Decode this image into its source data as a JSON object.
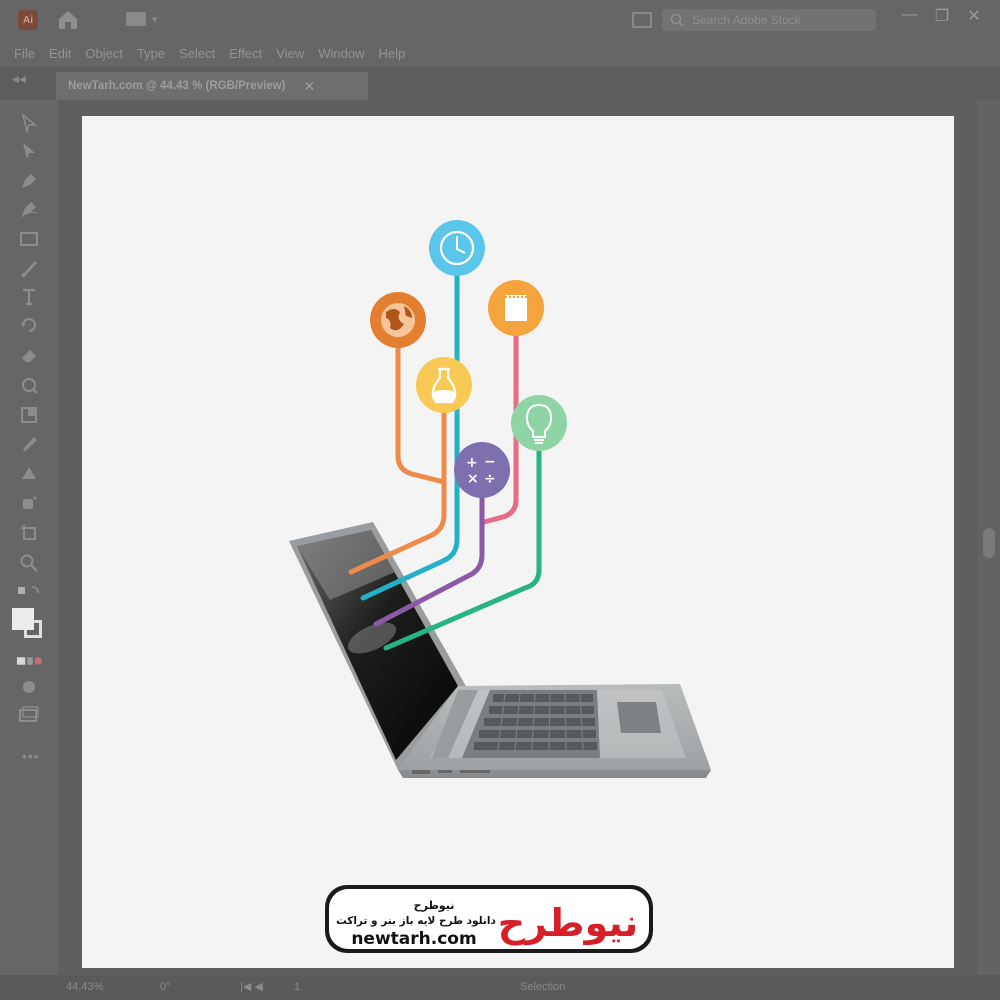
{
  "app": {
    "logo_text": "Ai"
  },
  "search": {
    "placeholder": "Search Adobe Stock"
  },
  "window": {
    "minimize": "—",
    "restore": "❐",
    "close": "✕"
  },
  "menu": [
    "File",
    "Edit",
    "Object",
    "Type",
    "Select",
    "Effect",
    "View",
    "Window",
    "Help"
  ],
  "document": {
    "tab_title": "NewTarh.com @ 44.43 % (RGB/Preview)",
    "close": "✕"
  },
  "status": {
    "zoom": "44.43%",
    "rotation": "0°",
    "page": "1",
    "tool": "Selection"
  },
  "icons": {
    "tools": [
      "selection-tool",
      "direct-selection-tool",
      "pen-tool",
      "curvature-tool",
      "rectangle-tool",
      "paintbrush-tool",
      "type-tool",
      "rotate-tool",
      "eraser-tool",
      "width-tool",
      "free-transform-tool",
      "eyedropper-tool",
      "blend-tool",
      "symbol-sprayer-tool",
      "artboard-tool",
      "zoom-tool"
    ],
    "bubbles": [
      "clock-icon",
      "globe-icon",
      "notepad-icon",
      "flask-icon",
      "lightbulb-icon",
      "math-symbols-icon"
    ]
  },
  "colors": {
    "clock": "#5bc6ea",
    "globe": "#e47f2f",
    "notepad": "#f3a43c",
    "flask": "#f9c955",
    "bulb": "#8fd4a5",
    "math": "#7e6fae",
    "line_orange": "#ee8b4b",
    "line_blue": "#23b1c7",
    "line_pink": "#ea6b88",
    "line_purple": "#8b5aa6",
    "line_green": "#26b484"
  },
  "watermark": {
    "logo_persian": "نیوطرح",
    "title_persian": "نیوطرح",
    "tagline_persian": "دانلود طرح لایه باز بنر و تراکت",
    "url": "newtarh.com"
  }
}
